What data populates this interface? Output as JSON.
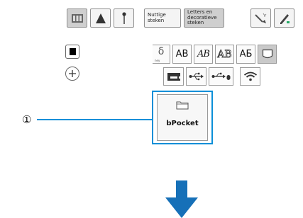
{
  "toolbar": {
    "useful_stitches_label": "Nuttige\nsteken",
    "letters_label": "Letters en\ndecoratieve\nsteken"
  },
  "categories": {
    "tiny_label": "ney",
    "font_ab_1": "AB",
    "font_ab_2": "AB",
    "font_ab_3": "AB",
    "font_ab_4": "AБ"
  },
  "folder": {
    "label": "bPocket"
  },
  "callout": {
    "number": "①"
  },
  "icons": {
    "embroidery_frame": "embroidery-frame-icon",
    "stitch_foot": "presser-foot-icon",
    "needle": "needle-icon",
    "wand": "edit-wand-icon",
    "pencil": "drawing-icon",
    "color_square": "black-square-icon",
    "plus": "plus-icon",
    "machine": "sewing-machine-icon",
    "usb": "usb-icon",
    "usb_mouse": "usb-device-icon",
    "wifi": "wifi-icon",
    "pocket": "pocket-icon",
    "folder": "folder-icon",
    "arrow": "arrow-down-icon"
  },
  "colors": {
    "highlight": "#0b8fd8",
    "arrow": "#1670b8",
    "button_border": "#8f8f8f"
  }
}
